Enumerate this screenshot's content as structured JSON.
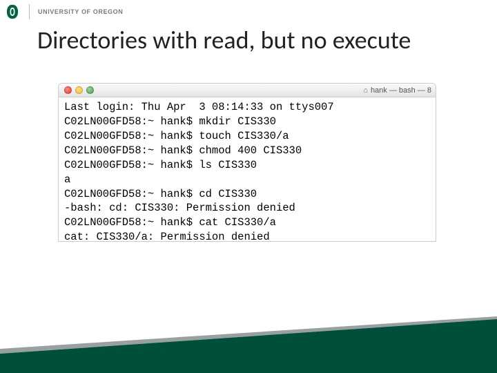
{
  "header": {
    "institution": "UNIVERSITY OF OREGON",
    "logo_accent": "#006547"
  },
  "slide": {
    "title": "Directories with read, but no execute"
  },
  "terminal": {
    "window_title": "hank — bash — 8",
    "lines": [
      "Last login: Thu Apr  3 08:14:33 on ttys007",
      "C02LN00GFD58:~ hank$ mkdir CIS330",
      "C02LN00GFD58:~ hank$ touch CIS330/a",
      "C02LN00GFD58:~ hank$ chmod 400 CIS330",
      "C02LN00GFD58:~ hank$ ls CIS330",
      "a",
      "C02LN00GFD58:~ hank$ cd CIS330",
      "-bash: cd: CIS330: Permission denied",
      "C02LN00GFD58:~ hank$ cat CIS330/a",
      "cat: CIS330/a: Permission denied"
    ]
  },
  "colors": {
    "brand_green": "#004F3A"
  }
}
